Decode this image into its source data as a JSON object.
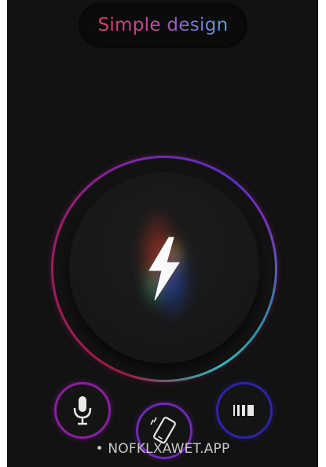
{
  "header": {
    "title_word_1": "Simple",
    "title_word_2": "design"
  },
  "power": {
    "icon": "lightning-bolt-icon",
    "state": "on"
  },
  "controls": [
    {
      "icon": "microphone-icon"
    },
    {
      "icon": "shake-phone-icon"
    },
    {
      "icon": "strobe-icon"
    }
  ],
  "watermark": {
    "text": "• NOFKLXAWET.APP"
  },
  "colors": {
    "background": "#121212",
    "title_pink": "#e2356e",
    "title_blue": "#5aa0e6",
    "ring_red": "#a11d3f",
    "ring_purple": "#6d2bb8",
    "ring_teal": "#30c0c0",
    "mic_ring": "#8a1fa0",
    "shake_ring": "#6d2ab5",
    "strobe_ring": "#3022a8"
  }
}
